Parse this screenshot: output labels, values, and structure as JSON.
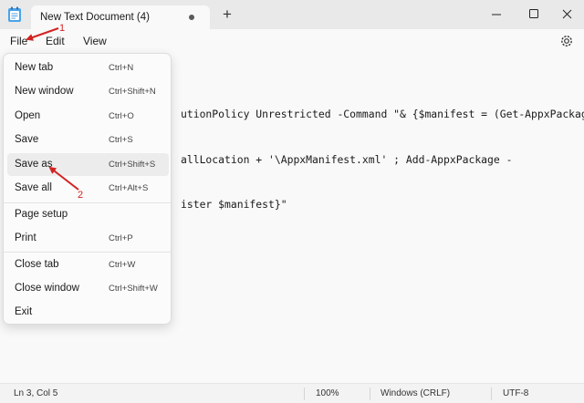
{
  "titlebar": {
    "tab_title": "New Text Document (4)",
    "new_tab_label": "+"
  },
  "menubar": {
    "file": "File",
    "edit": "Edit",
    "view": "View"
  },
  "editor": {
    "lines": [
      "utionPolicy Unrestricted -Command \"& {$manifest = (Get-AppxPackage",
      "allLocation + '\\AppxManifest.xml' ; Add-AppxPackage -",
      "ister $manifest}\""
    ]
  },
  "file_menu": {
    "items": [
      {
        "label": "New tab",
        "shortcut": "Ctrl+N"
      },
      {
        "label": "New window",
        "shortcut": "Ctrl+Shift+N"
      },
      {
        "label": "Open",
        "shortcut": "Ctrl+O"
      },
      {
        "label": "Save",
        "shortcut": "Ctrl+S"
      },
      {
        "label": "Save as",
        "shortcut": "Ctrl+Shift+S"
      },
      {
        "label": "Save all",
        "shortcut": "Ctrl+Alt+S"
      },
      {
        "label": "Page setup",
        "shortcut": ""
      },
      {
        "label": "Print",
        "shortcut": "Ctrl+P"
      },
      {
        "label": "Close tab",
        "shortcut": "Ctrl+W"
      },
      {
        "label": "Close window",
        "shortcut": "Ctrl+Shift+W"
      },
      {
        "label": "Exit",
        "shortcut": ""
      }
    ]
  },
  "statusbar": {
    "position": "Ln 3, Col 5",
    "zoom": "100%",
    "line_ending": "Windows (CRLF)",
    "encoding": "UTF-8"
  },
  "annotations": {
    "step1": "1",
    "step2": "2",
    "color": "#d32222"
  },
  "icons": {
    "app": "notepad-icon",
    "close_dot": "tab-close-dot",
    "settings": "gear-icon"
  }
}
